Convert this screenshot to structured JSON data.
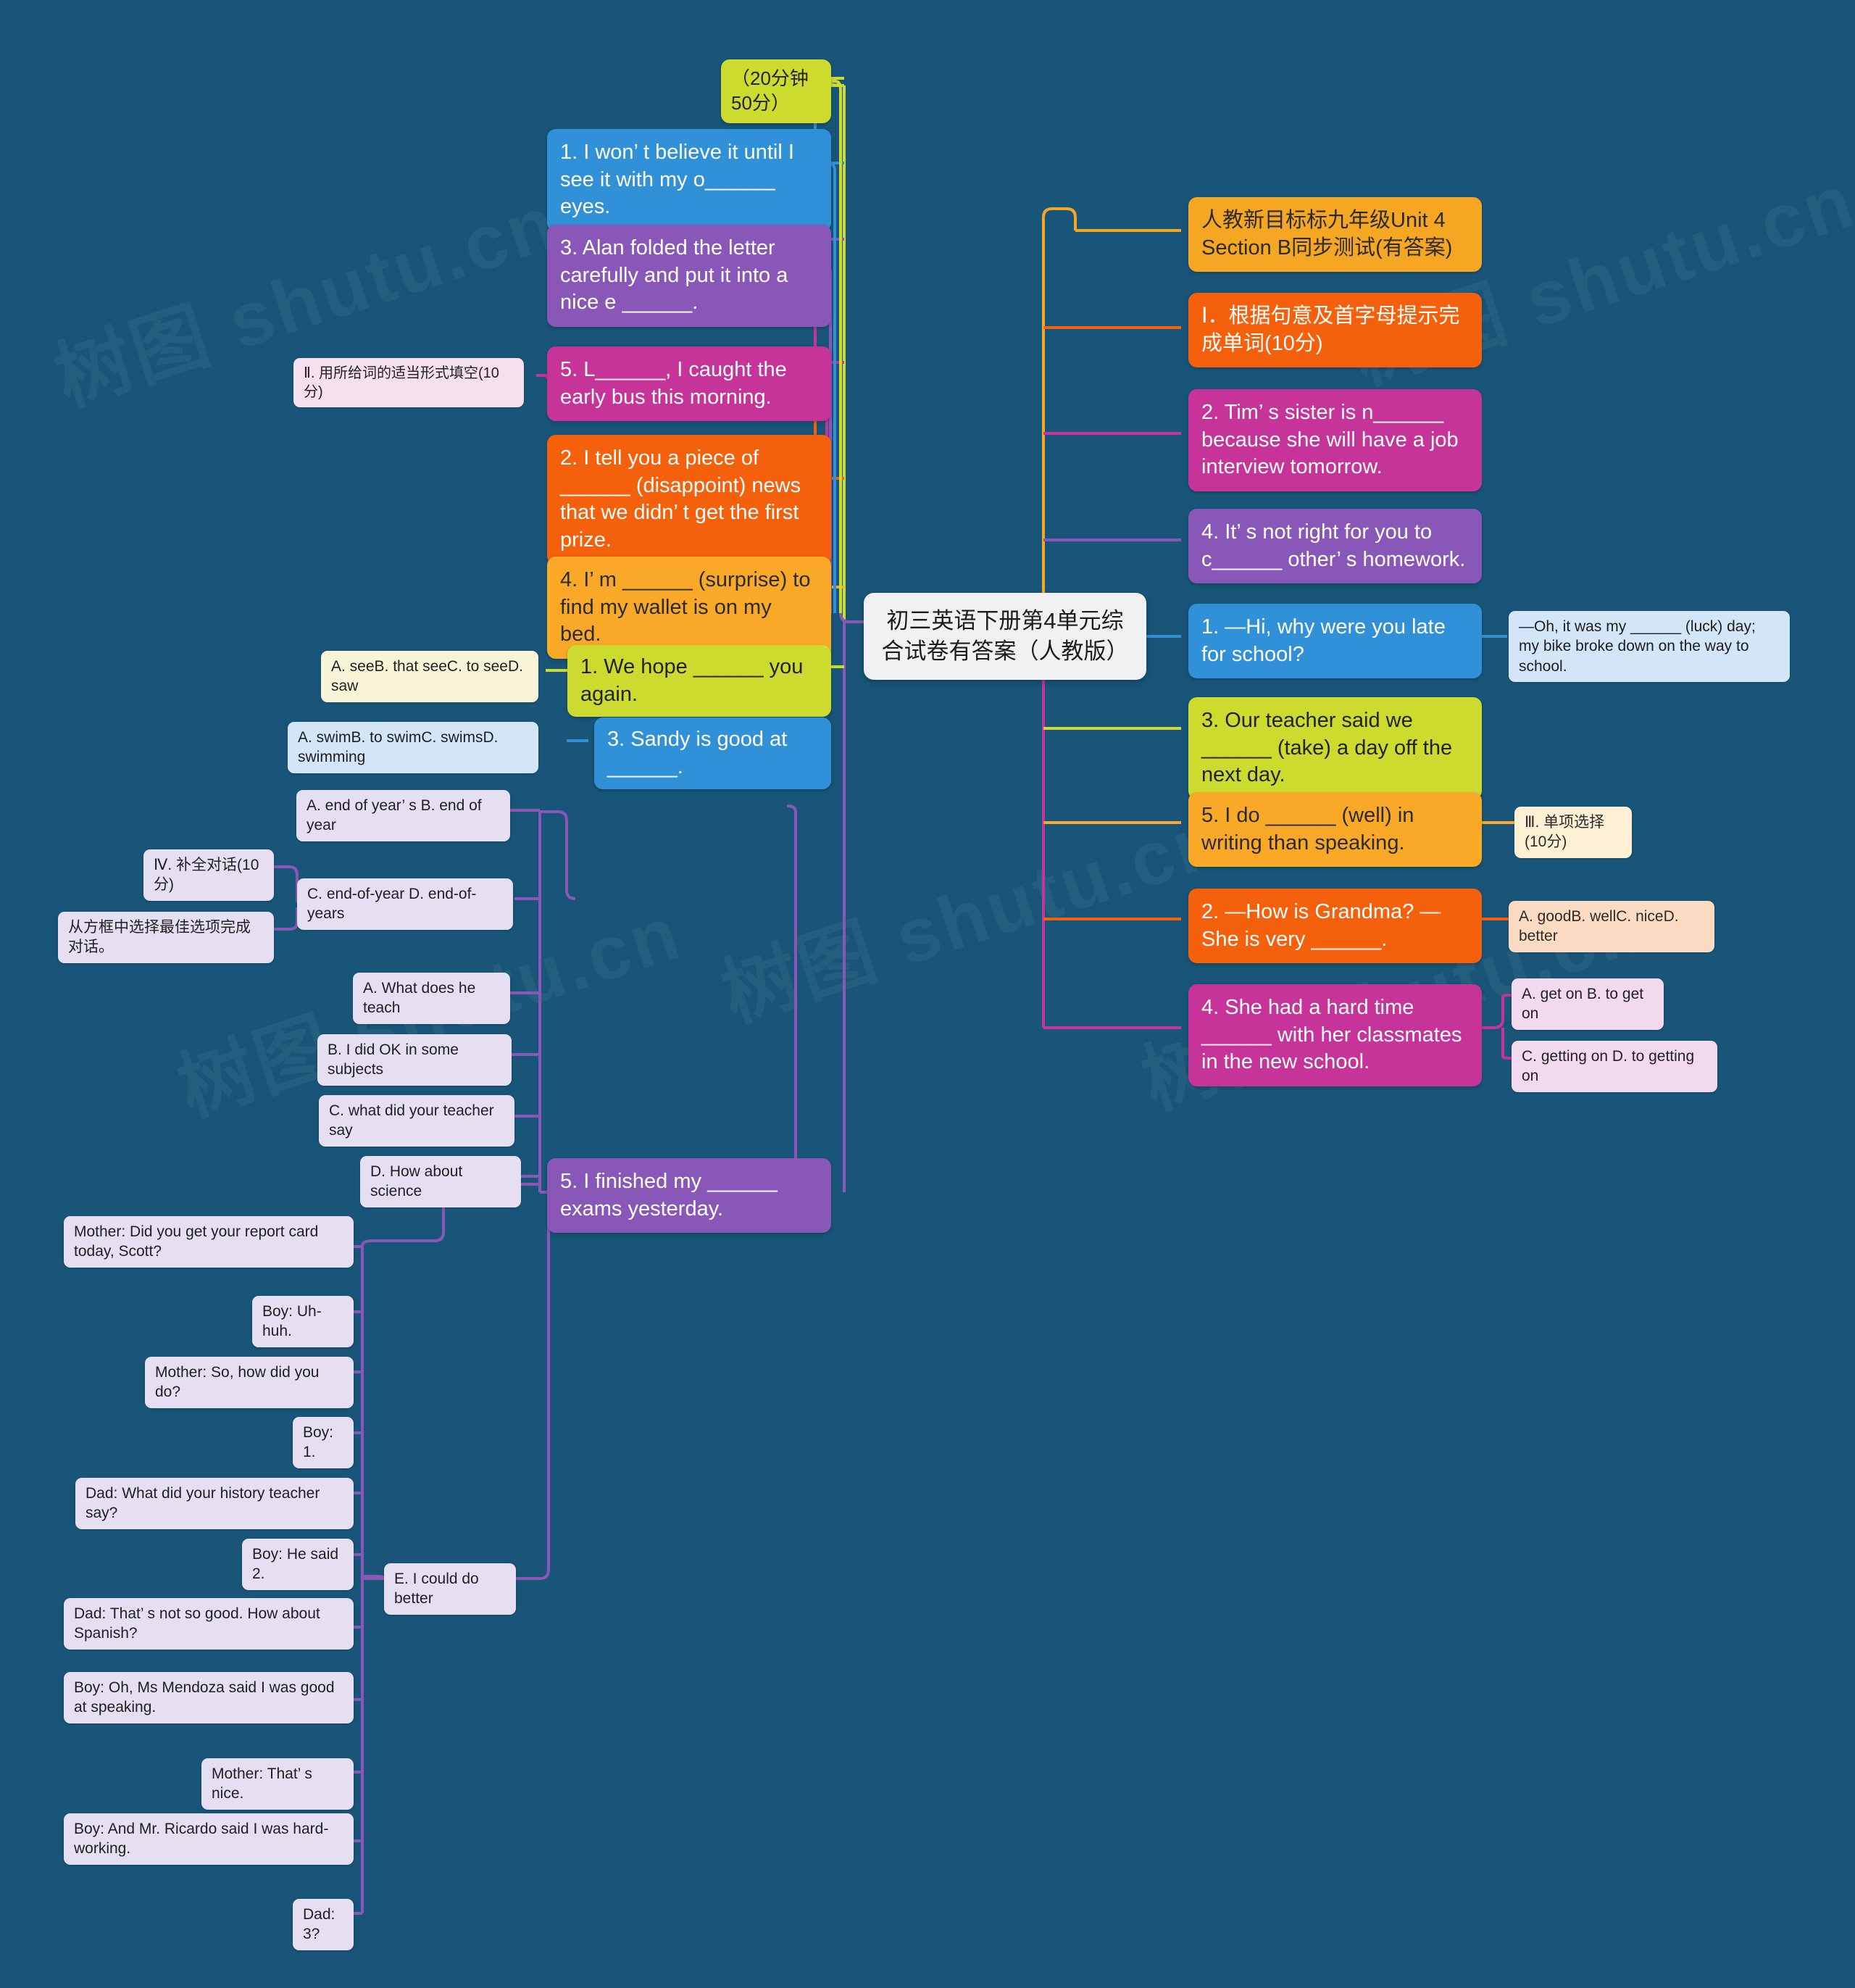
{
  "background": "#185578",
  "watermarks": [
    "树图 shutu.cn",
    "树图 shutu.cn",
    "树图 shutu.cn",
    "树图 shutu.cn",
    "树图 shutu.cn"
  ],
  "central": {
    "title": "初三英语下册第4单元综合试卷有答案（人教版）"
  },
  "nodes": {
    "time_limit": "（20分钟50分）",
    "q1_o_eyes": "1. I won’ t believe it until I see it with my o______ eyes.",
    "q3_envelope": "3. Alan folded the letter carefully and put it into a nice e ______.",
    "section2_title": "Ⅱ. 用所给词的适当形式填空(10分)",
    "q5_luckily": "5. L______, I caught the early bus this morning.",
    "q2_disappoint": "2. I tell you a piece of ______ (disappoint) news that we didn’ t get the first prize.",
    "q4_surprise": "4. I’ m ______ (surprise) to find my wallet is on my bed.",
    "opt_see": "A. seeB. that seeC. to seeD. saw",
    "q1_we_hope": "1. We hope ______ you again.",
    "opt_swim": "A. swimB. to swimC. swimsD. swimming",
    "q3_sandy": "3. Sandy is good at ______.",
    "opt_end_of_year_ab": "A. end of year’ s B. end of year",
    "section4_title": "Ⅳ. 补全对话(10分)",
    "section4_sub": "从方框中选择最佳选项完成对话。",
    "opt_end_of_year_cd": "C. end-of-year D. end-of-years",
    "opt_a_teach": "A. What does he teach",
    "opt_b_ok": "B. I did OK in some subjects",
    "opt_c_say": "C. what did your teacher say",
    "opt_d_science": "D. How about science",
    "q5_finished": "5. I finished my ______ exams yesterday.",
    "dlg_mother_1": "Mother: Did you get your report card today, Scott?",
    "dlg_boy_1": "Boy: Uh-huh.",
    "dlg_mother_2": "Mother: So, how did you do?",
    "dlg_boy_2": "Boy: 1.",
    "dlg_dad_1": "Dad: What did your history teacher say?",
    "dlg_boy_3": "Boy: He said 2.",
    "opt_e_better": "E. I could do better",
    "dlg_dad_2": "Dad: That’ s not so good. How about Spanish?",
    "dlg_boy_4": "Boy: Oh, Ms Mendoza said I was good at speaking.",
    "dlg_mother_3": "Mother: That’ s nice.",
    "dlg_boy_5": "Boy: And Mr. Ricardo said I was hard-working.",
    "dlg_dad_3": "Dad: 3?",
    "unit_title": "人教新目标标九年级Unit 4 Section B同步测试(有答案)",
    "section1_title": "Ⅰ．根据句意及首字母提示完成单词(10分)",
    "q2_nervous": "2. Tim’ s sister is n______ because she will have a job interview tomorrow.",
    "q4_copy": "4. It’ s not right for you to c______ other’ s homework.",
    "q1_late": "1. —Hi, why were you late for school?",
    "q1_late_answer": "—Oh, it was my ______ (luck) day; my bike broke down on the way to school.",
    "q3_take": "3. Our teacher said we ______ (take) a day off the next day.",
    "q5_well": "5. I do ______ (well) in writing than speaking.",
    "section3_title": "Ⅲ. 单项选择(10分)",
    "q2_grandma": "2. —How is Grandma? —She is very ______.",
    "opt_good_well": "A. goodB. wellC. niceD. better",
    "q4_hard_time": "4. She had a hard time ______ with her classmates in the new school.",
    "opt_get_on_ab": "A. get on B. to get on",
    "opt_get_on_cd": "C. getting on D. to getting on"
  },
  "colors": {
    "lime": "#ccdb2e",
    "blue": "#3090d8",
    "purple": "#8957b8",
    "magenta": "#c63399",
    "orange": "#f4600c",
    "amber": "#f9a927",
    "gold": "#f5a623",
    "background": "#185578"
  }
}
